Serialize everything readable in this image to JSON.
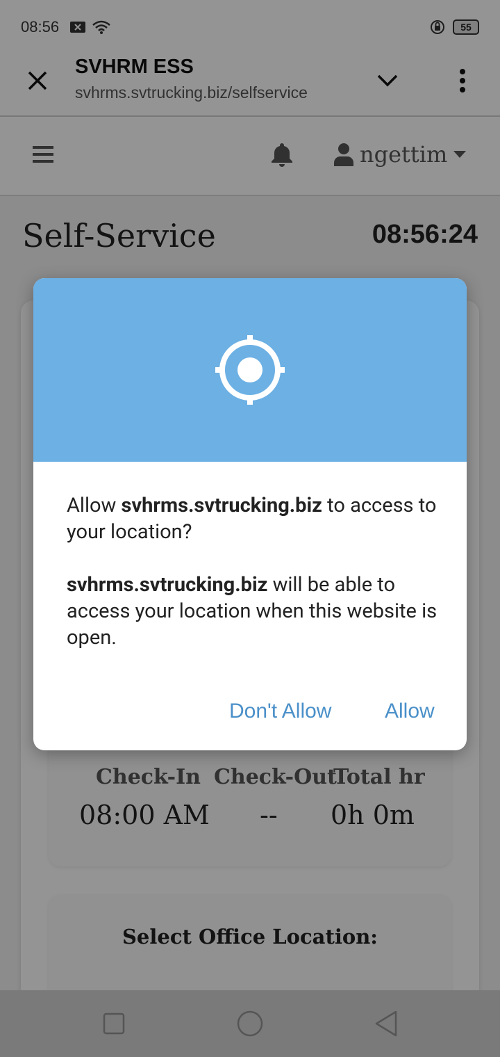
{
  "status_bar": {
    "time": "08:56",
    "battery": "55"
  },
  "browser": {
    "title": "SVHRM ESS",
    "url": "svhrms.svtrucking.biz/selfservice"
  },
  "app_header": {
    "username": "ngettim"
  },
  "main": {
    "title": "Self-Service",
    "clock": "08:56:24",
    "attendance": {
      "headers": [
        "Check-In",
        "Check-Out",
        "Total hr"
      ],
      "values": [
        "08:00 AM",
        "--",
        "0h 0m"
      ]
    },
    "location_label": "Select Office Location:"
  },
  "dialog": {
    "line1_prefix": "Allow ",
    "line1_site": "svhrms.svtrucking.biz",
    "line1_suffix": " to access to your location?",
    "line2_site": "svhrms.svtrucking.biz",
    "line2_suffix": " will be able to access your location when this website is open.",
    "deny_label": "Don't Allow",
    "allow_label": "Allow"
  },
  "colors": {
    "dialog_header": "#6cb0e4",
    "dialog_button": "#4a90c9"
  }
}
